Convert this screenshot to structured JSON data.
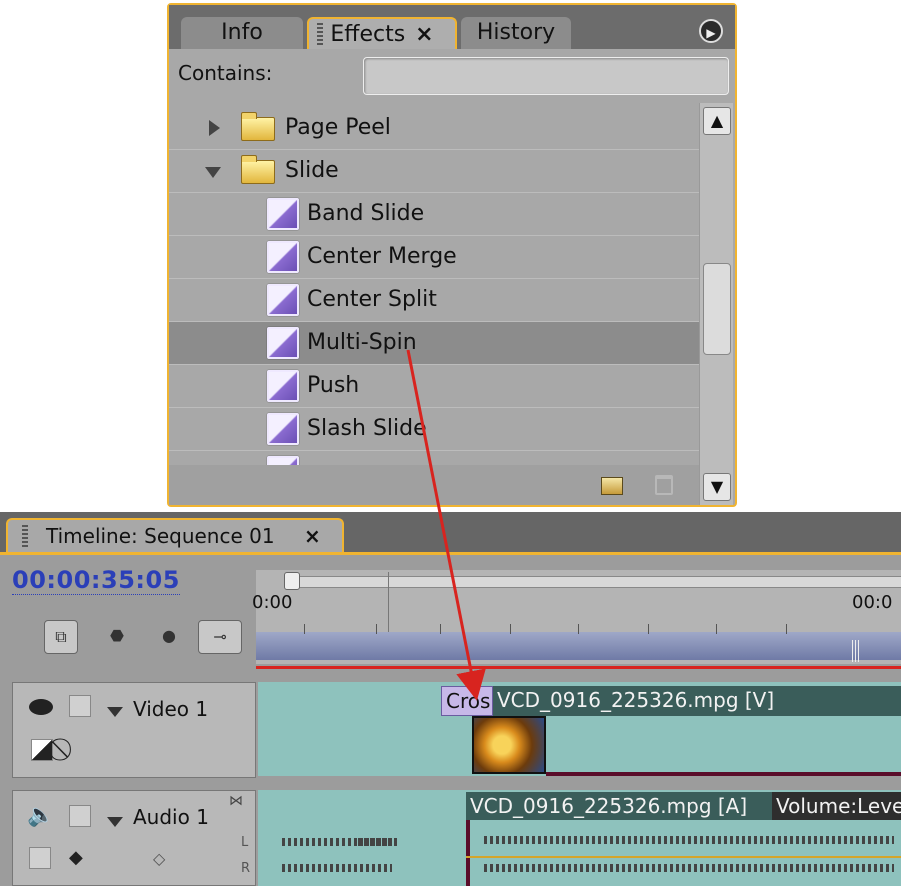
{
  "effects_panel": {
    "tabs": [
      {
        "label": "Info"
      },
      {
        "label": "Effects",
        "close": "×"
      },
      {
        "label": "History"
      }
    ],
    "contains_label": "Contains:",
    "search_value": "",
    "tree": [
      {
        "label": "Page Peel",
        "type": "folder",
        "expanded": false
      },
      {
        "label": "Slide",
        "type": "folder",
        "expanded": true
      },
      {
        "label": "Band Slide",
        "type": "effect"
      },
      {
        "label": "Center Merge",
        "type": "effect"
      },
      {
        "label": "Center Split",
        "type": "effect"
      },
      {
        "label": "Multi-Spin",
        "type": "effect",
        "selected": true
      },
      {
        "label": "Push",
        "type": "effect"
      },
      {
        "label": "Slash Slide",
        "type": "effect"
      }
    ]
  },
  "timeline": {
    "tab_title": "Timeline: Sequence 01",
    "tab_close": "×",
    "timecode": "00:00:35:05",
    "ruler_start": "0:00",
    "ruler_end": "00:0",
    "tracks": {
      "video": {
        "name": "Video 1",
        "transition_label": "Cros",
        "clip_label": "VCD_0916_225326.mpg [V]"
      },
      "audio": {
        "name": "Audio 1",
        "clip_label": "VCD_0916_225326.mpg [A]",
        "volume_label": "Volume:Leve",
        "channel_l": "L",
        "channel_r": "R"
      }
    }
  },
  "colors": {
    "panel_border": "#f0b431",
    "timecode": "#2b3fb8",
    "drag_arrow": "#d8241f",
    "clip": "#8ec2bd"
  }
}
